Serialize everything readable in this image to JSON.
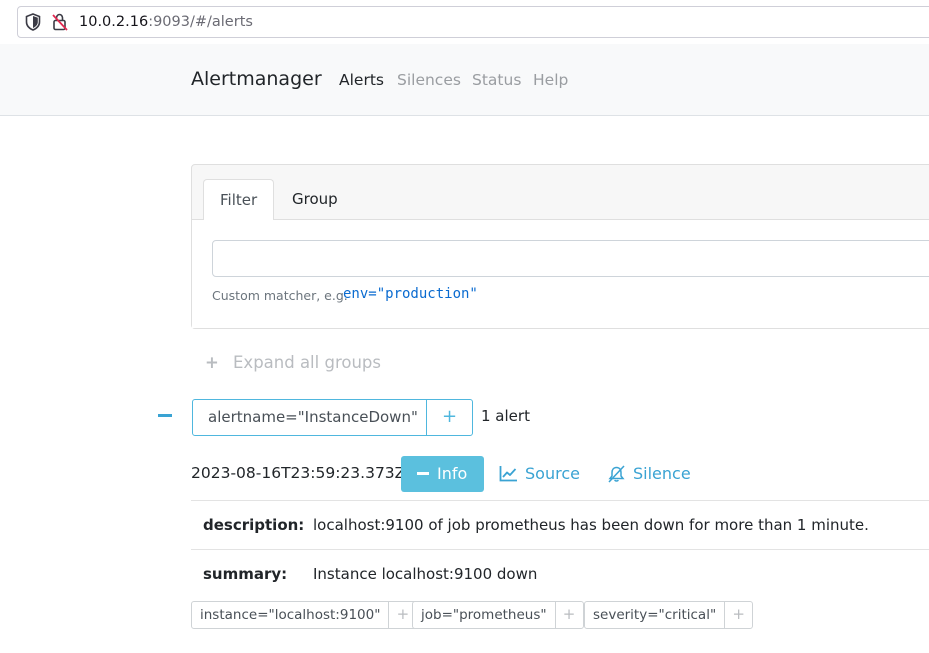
{
  "browser": {
    "url_host": "10.0.2.16",
    "url_rest": ":9093/#/alerts"
  },
  "navbar": {
    "brand": "Alertmanager",
    "links": [
      "Alerts",
      "Silences",
      "Status",
      "Help"
    ],
    "active": "Alerts"
  },
  "filter": {
    "tabs": [
      "Filter",
      "Group"
    ],
    "active_tab": "Filter",
    "input_value": "",
    "hint": "Custom matcher, e.g.",
    "hint_example": "env=\"production\""
  },
  "expand_all": "Expand all groups",
  "group": {
    "label": "alertname=\"InstanceDown\"",
    "plus": "+",
    "count": "1 alert"
  },
  "alert": {
    "timestamp": "2023-08-16T23:59:23.373Z",
    "info_label": "Info",
    "source_label": "Source",
    "silence_label": "Silence",
    "annotations": [
      {
        "key": "description:",
        "value": "localhost:9100 of job prometheus has been down for more than 1 minute."
      },
      {
        "key": "summary:",
        "value": "Instance localhost:9100 down"
      }
    ],
    "labels": [
      {
        "text": "instance=\"localhost:9100\"",
        "plus": "+"
      },
      {
        "text": "job=\"prometheus\"",
        "plus": "+"
      },
      {
        "text": "severity=\"critical\"",
        "plus": "+"
      }
    ]
  },
  "colors": {
    "accent": "#5bc0de",
    "link": "#3aa3d3",
    "navbar_bg": "#f8f9fa"
  }
}
